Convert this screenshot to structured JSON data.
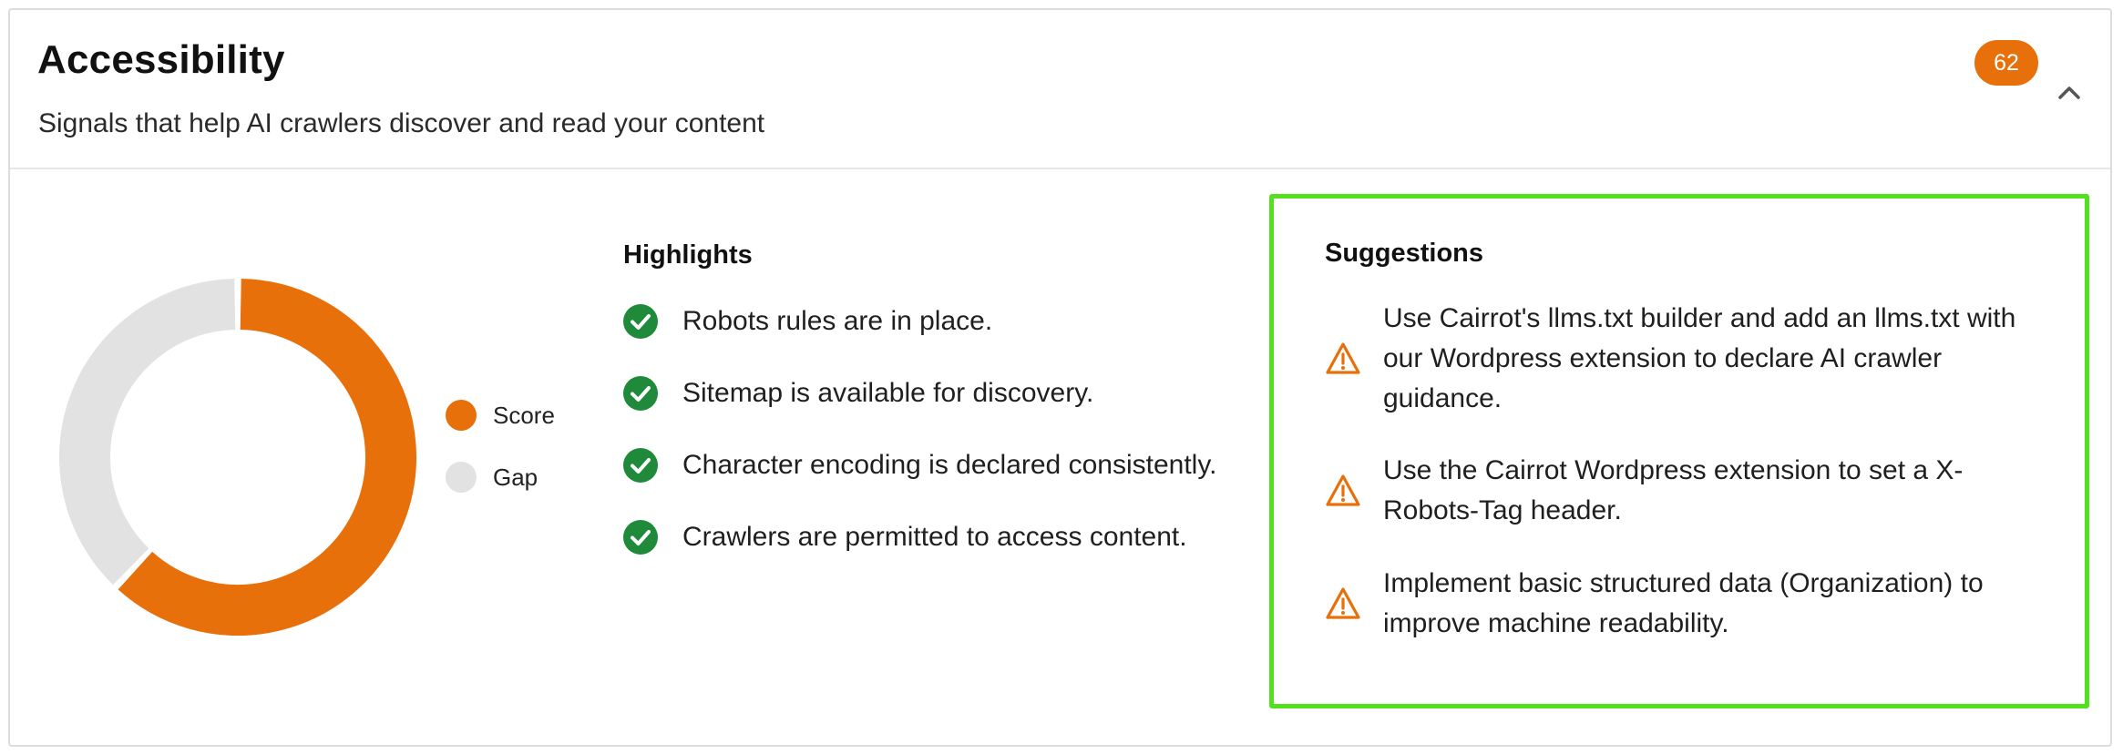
{
  "section": {
    "title": "Accessibility",
    "subtitle": "Signals that help AI crawlers discover and read your content",
    "score": "62",
    "collapse_icon": "chevron-up-icon"
  },
  "donut": {
    "score_fraction": 0.62,
    "score_color": "#e8700a",
    "gap_color": "#e2e2e2"
  },
  "legend": {
    "items": [
      {
        "label": "Score",
        "color": "#e8700a"
      },
      {
        "label": "Gap",
        "color": "#e2e2e2"
      }
    ]
  },
  "highlights": {
    "title": "Highlights",
    "icon": "check-circle-icon",
    "icon_color": "#1e8a3a",
    "items": [
      "Robots rules are in place.",
      "Sitemap is available for discovery.",
      "Character encoding is declared consistently.",
      "Crawlers are permitted to access content."
    ]
  },
  "suggestions": {
    "title": "Suggestions",
    "icon": "warning-icon",
    "icon_color": "#e8700a",
    "items": [
      "Use Cairrot's llms.txt builder and add an llms.txt with our Wordpress extension to declare AI crawler guidance.",
      "Use the Cairrot Wordpress extension to set a X-Robots-Tag header.",
      "Implement basic structured data (Organization) to improve machine readability."
    ]
  }
}
